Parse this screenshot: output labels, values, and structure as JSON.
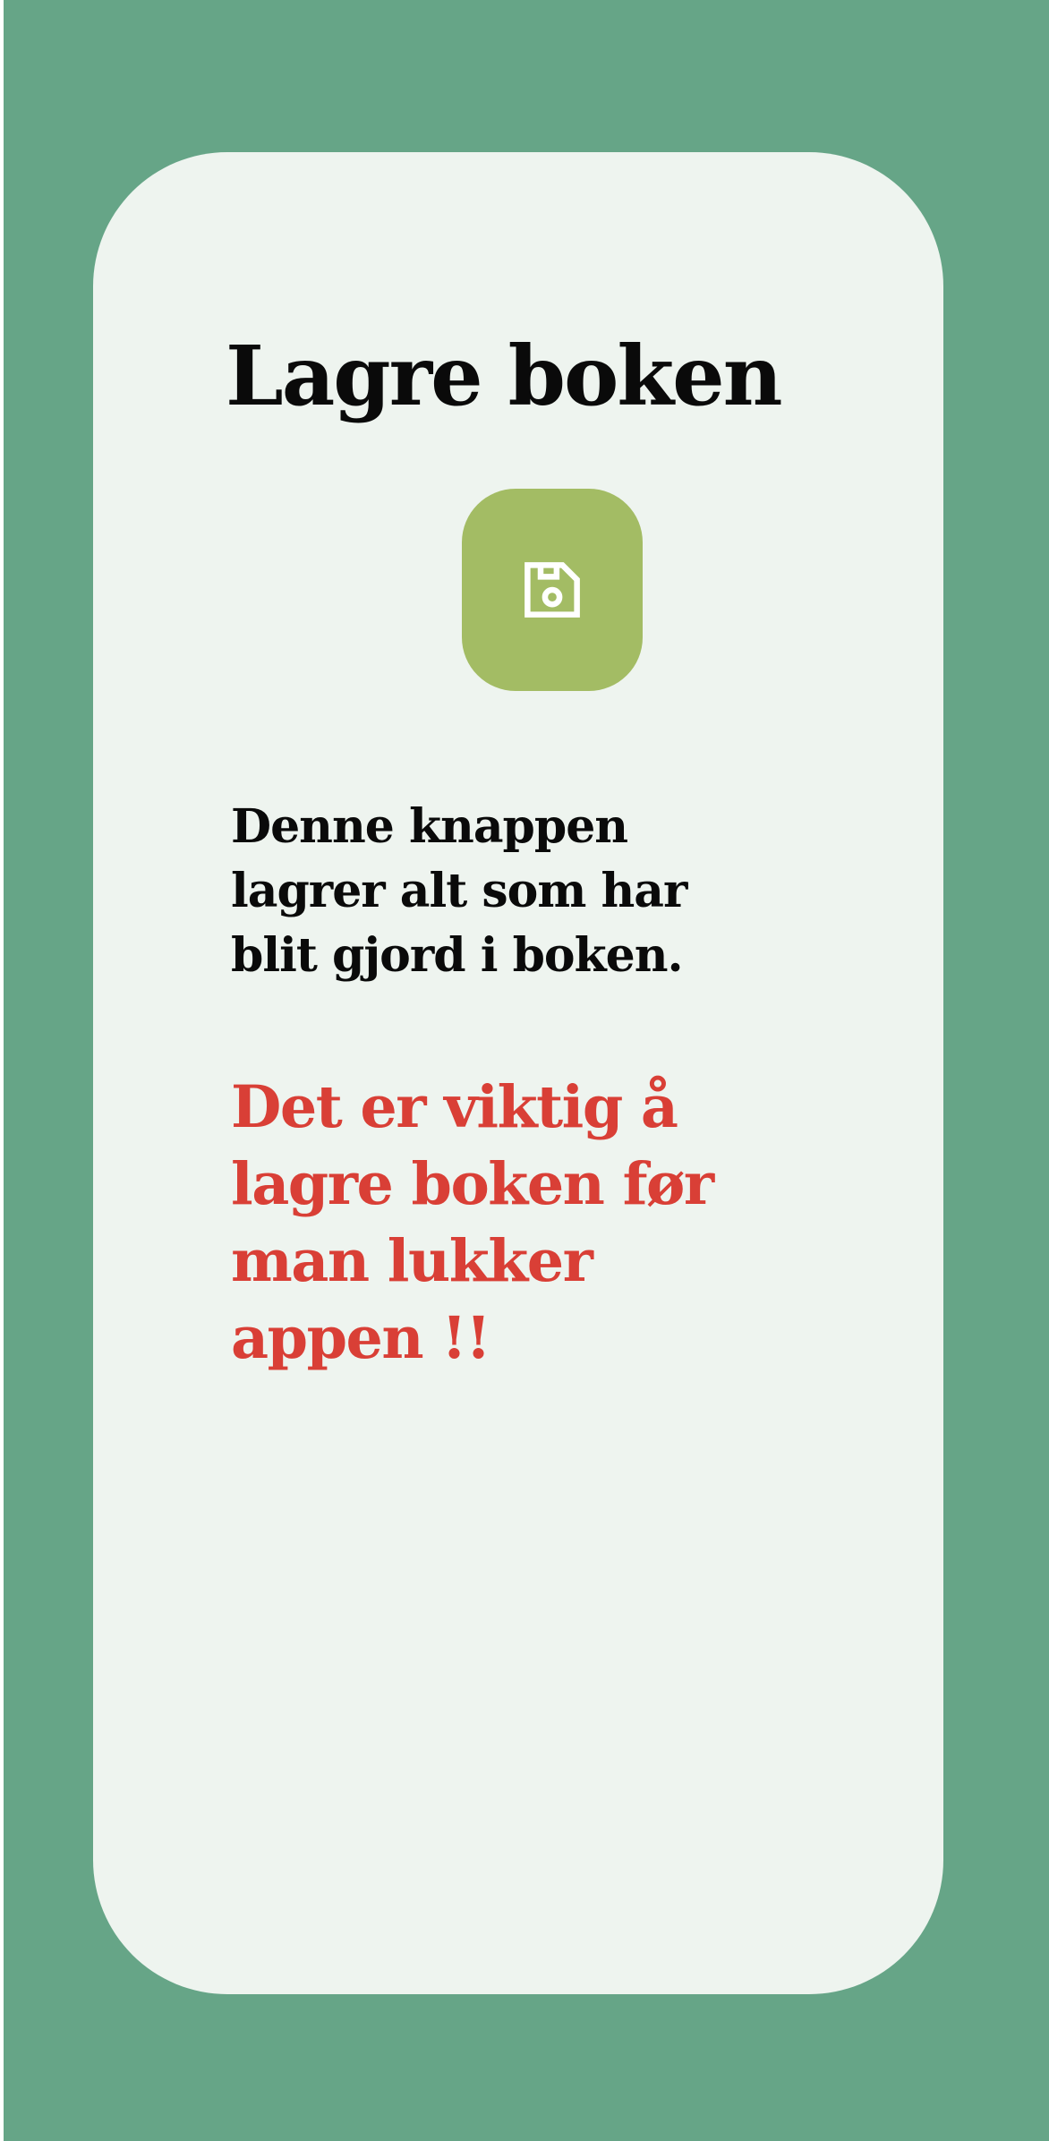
{
  "page": {
    "title": "Lagre boken",
    "description_lines": [
      "Denne knappen",
      "lagrer alt som har",
      "blit gjord i boken."
    ],
    "warning_lines": [
      "Det er viktig å",
      "lagre boken før",
      "man lukker",
      "appen !!"
    ]
  },
  "save_button": {
    "icon": "save-icon"
  },
  "colors": {
    "background": "#66a587",
    "card": "#eef4ef",
    "button": "#a3bc64",
    "warning_text": "#d93f36",
    "text": "#0a0a0a"
  }
}
